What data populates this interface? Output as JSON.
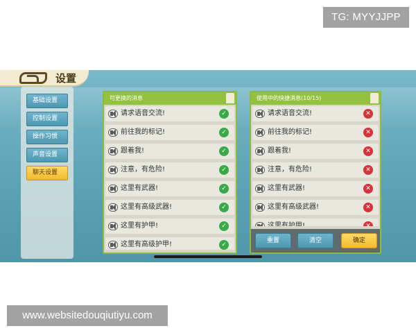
{
  "watermarks": {
    "top": "TG: MYYJJPP",
    "bottom": "www.websitedouqiutiyu.com"
  },
  "header": {
    "back_icon": "back-logo-icon",
    "title": "设置"
  },
  "sidebar": {
    "items": [
      {
        "label": "基础设置",
        "active": false
      },
      {
        "label": "控制设置",
        "active": false
      },
      {
        "label": "操作习惯",
        "active": false
      },
      {
        "label": "声音设置",
        "active": false
      },
      {
        "label": "聊天设置",
        "active": true
      }
    ]
  },
  "left_panel": {
    "title": "可更换的消息",
    "items": [
      {
        "label": "请求语音交流!",
        "status": "✓"
      },
      {
        "label": "前往我的标记!",
        "status": "✓"
      },
      {
        "label": "跟着我!",
        "status": "✓"
      },
      {
        "label": "注意，有危险!",
        "status": "✓"
      },
      {
        "label": "这里有武器!",
        "status": "✓"
      },
      {
        "label": "这里有高级武器!",
        "status": "✓"
      },
      {
        "label": "这里有护甲!",
        "status": "✓"
      },
      {
        "label": "这里有高级护甲!",
        "status": "✓"
      }
    ]
  },
  "right_panel": {
    "title": "使用中的快捷消息(10/15)",
    "items": [
      {
        "label": "请求语音交流!",
        "status": "✕"
      },
      {
        "label": "前往我的标记!",
        "status": "✕"
      },
      {
        "label": "跟着我!",
        "status": "✕"
      },
      {
        "label": "注意，有危险!",
        "status": "✕"
      },
      {
        "label": "这里有武器!",
        "status": "✕"
      },
      {
        "label": "这里有高级武器!",
        "status": "✕"
      },
      {
        "label": "这里有护甲!",
        "status": "✕"
      }
    ],
    "buttons": {
      "reset": "重置",
      "clear": "清空",
      "confirm": "确定"
    }
  },
  "colors": {
    "accent_green": "#93c23e",
    "ok_green": "#39a94a",
    "remove_red": "#d7333b",
    "tab_blue": "#4f98b3",
    "active_yellow": "#f2bb2e"
  }
}
